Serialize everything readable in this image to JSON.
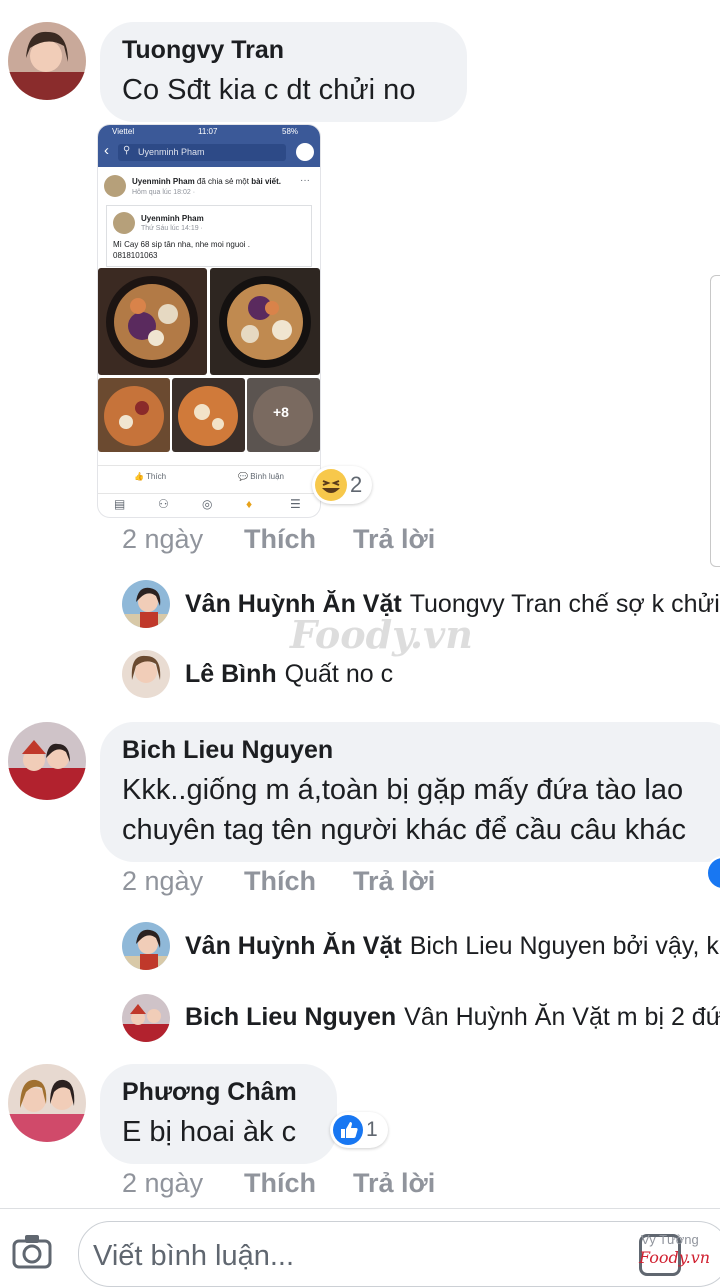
{
  "comments": [
    {
      "author": "Tuongvy Tran",
      "text": "Co Sđt kia c dt chửi no",
      "reaction_count": "2",
      "meta": {
        "time": "2 ngày",
        "like": "Thích",
        "reply": "Trả lời"
      },
      "replies": [
        {
          "author": "Vân Huỳnh Ăn Vặt",
          "text": "Tuongvy Tran chế sợ k chửi"
        },
        {
          "author": "Lê Bình",
          "text": "Quất no c"
        }
      ]
    },
    {
      "author": "Bich Lieu Nguyen",
      "text_line1": "Kkk..giống m á,toàn bị gặp mấy đứa tào lao",
      "text_line2": "chuyên tag tên người khác để cầu câu khác",
      "meta": {
        "time": "2 ngày",
        "like": "Thích",
        "reply": "Trả lời"
      },
      "replies": [
        {
          "author": "Vân Huỳnh Ăn Vặt",
          "text": "Bich Lieu Nguyen bởi vậy, k"
        },
        {
          "author": "Bich Lieu Nguyen",
          "text": "Vân Huỳnh Ăn Vặt m bị 2 đứ"
        }
      ]
    },
    {
      "author": "Phương Châm",
      "text": "E bị hoai àk c",
      "reaction_count": "1",
      "meta": {
        "time": "2 ngày",
        "like": "Thích",
        "reply": "Trả lời"
      }
    }
  ],
  "screenshot": {
    "carrier": "Viettel",
    "time": "11:07",
    "battery": "58%",
    "search": "Uyenminh Pham",
    "sharer": "Uyenminh Pham",
    "shared_text": "đã chia sẻ một",
    "shared_link": "bài viết.",
    "share_time": "Hôm qua lúc 18:02 · ",
    "orig_author": "Uyenminh Pham",
    "orig_time": "Thứ Sáu lúc 14:19 · ",
    "orig_line1": "Mì Cay 68 sip tân nha, nhe moi nguoi .",
    "orig_line2": "0818101063",
    "more_photos": "+8",
    "like": "Thích",
    "comment": "Bình luận"
  },
  "watermark": "Foody.vn",
  "input": {
    "placeholder": "Viết bình luận...",
    "user_hint": "Vy Tường"
  },
  "colors": {
    "bubble": "#f0f2f5",
    "meta": "#90949c",
    "fb_blue": "#3b5998",
    "like_blue": "#1877f2"
  },
  "icons": [
    "camera-icon",
    "laugh-reaction-icon",
    "like-reaction-icon",
    "sticker-icon"
  ]
}
